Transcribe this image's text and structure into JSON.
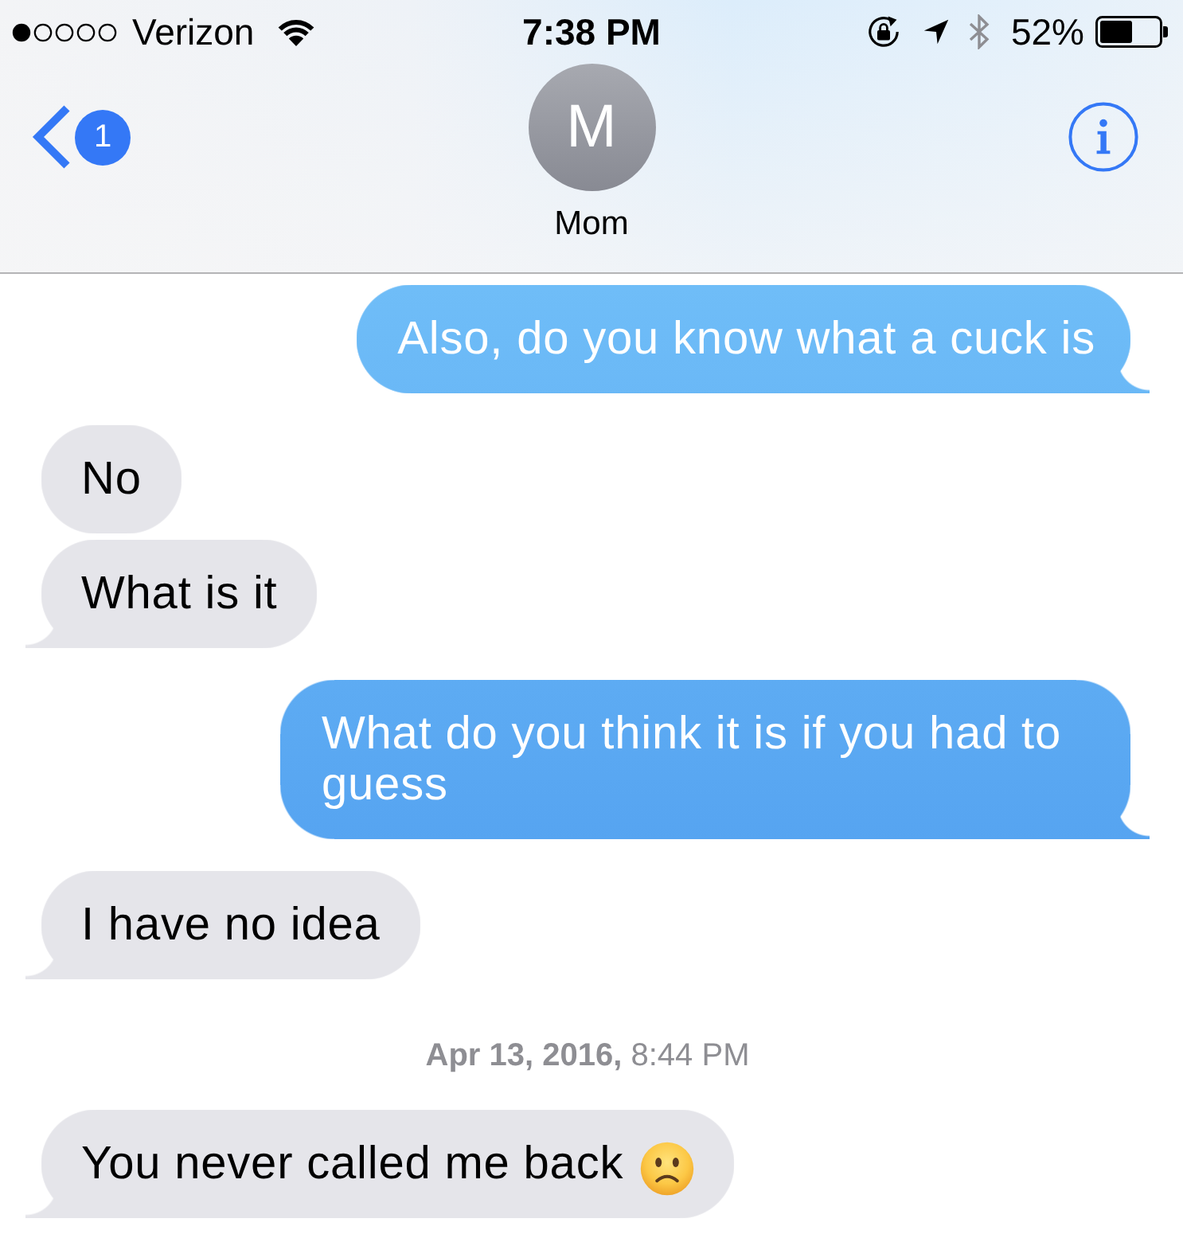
{
  "status_bar": {
    "carrier": "Verizon",
    "time": "7:38 PM",
    "battery_percent": "52%"
  },
  "nav": {
    "back_badge": "1",
    "contact": {
      "initial": "M",
      "name": "Mom"
    }
  },
  "messages": [
    {
      "kind": "sent",
      "text": "Also, do you know what a cuck is",
      "tail": true
    },
    {
      "kind": "received",
      "text": "No",
      "tail": false
    },
    {
      "kind": "received",
      "text": "What is it",
      "tail": true
    },
    {
      "kind": "sent",
      "text": "What do you think it is if you had to guess",
      "tail": true
    },
    {
      "kind": "received",
      "text": "I have no idea",
      "tail": true
    },
    {
      "kind": "timestamp",
      "text": "**Apr 13, 2016,** 8:44 PM"
    },
    {
      "kind": "received",
      "text": "You never called me back",
      "tail": true,
      "emoji": true
    }
  ]
}
